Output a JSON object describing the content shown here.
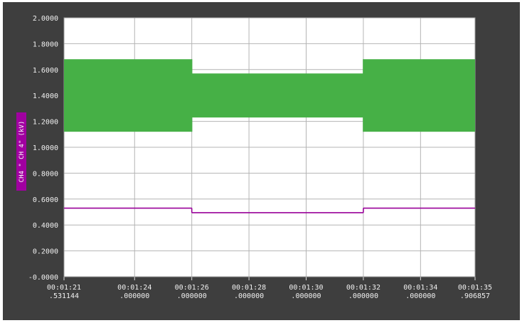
{
  "chart_data": {
    "type": "line",
    "ylabel": "CH4 \" CH 4\" (kV)",
    "ylim": [
      0.0,
      2.0
    ],
    "y_ticks": [
      "2.0000",
      "1.8000",
      "1.6000",
      "1.4000",
      "1.2000",
      "1.0000",
      "0.8000",
      "0.6000",
      "0.4000",
      "0.2000",
      "-0.0000"
    ],
    "xlim": [
      "00:01:21.531144",
      "00:01:35.906857"
    ],
    "x_ticks": [
      {
        "time": "00:01:21",
        "frac": ".531144"
      },
      {
        "time": "00:01:24",
        "frac": ".000000"
      },
      {
        "time": "00:01:26",
        "frac": ".000000"
      },
      {
        "time": "00:01:28",
        "frac": ".000000"
      },
      {
        "time": "00:01:30",
        "frac": ".000000"
      },
      {
        "time": "00:01:32",
        "frac": ".000000"
      },
      {
        "time": "00:01:34",
        "frac": ".000000"
      },
      {
        "time": "00:01:35",
        "frac": ".906857"
      }
    ],
    "grid": true,
    "series": [
      {
        "color": "#46b046",
        "style": "band",
        "segments": [
          {
            "x_start": "00:01:21.531144",
            "x_end": "00:01:26.000000",
            "ymin": 1.12,
            "ymax": 1.68
          },
          {
            "x_start": "00:01:26.000000",
            "x_end": "00:01:32.000000",
            "ymin": 1.23,
            "ymax": 1.57
          },
          {
            "x_start": "00:01:32.000000",
            "x_end": "00:01:35.906857",
            "ymin": 1.12,
            "ymax": 1.68
          }
        ]
      },
      {
        "color": "#990099",
        "style": "line",
        "segments": [
          {
            "x_start": "00:01:21.531144",
            "x_end": "00:01:26.000000",
            "y": 0.53
          },
          {
            "x_start": "00:01:26.000000",
            "x_end": "00:01:32.000000",
            "y": 0.495
          },
          {
            "x_start": "00:01:32.000000",
            "x_end": "00:01:35.906857",
            "y": 0.53
          }
        ]
      }
    ]
  }
}
